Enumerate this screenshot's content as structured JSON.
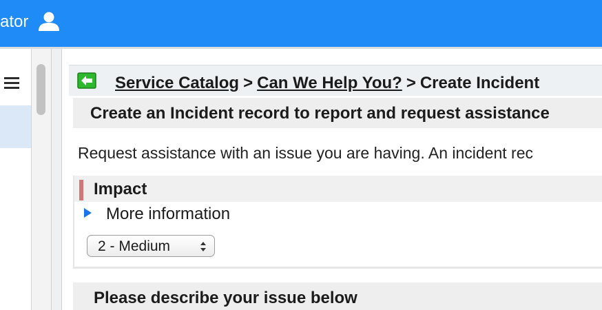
{
  "header": {
    "user_name": "ator",
    "user_icon": "user-icon",
    "background_color": "#1f8bf6"
  },
  "sidebar": {
    "menu_icon": "hamburger-menu-icon"
  },
  "breadcrumb": {
    "back_icon": "green-back-arrow-icon",
    "items": [
      {
        "label": "Service Catalog",
        "link": true
      },
      {
        "label": "Can We Help You?",
        "link": true
      },
      {
        "label": "Create Incident",
        "link": false
      }
    ],
    "separator": ">"
  },
  "form": {
    "title": "Create an Incident record to report and request assistance",
    "description": "Request assistance with an issue you are having. An incident rec",
    "impact": {
      "label": "Impact",
      "more_info": "More information",
      "selected": "2 - Medium"
    },
    "describe_label": "Please describe your issue below"
  }
}
